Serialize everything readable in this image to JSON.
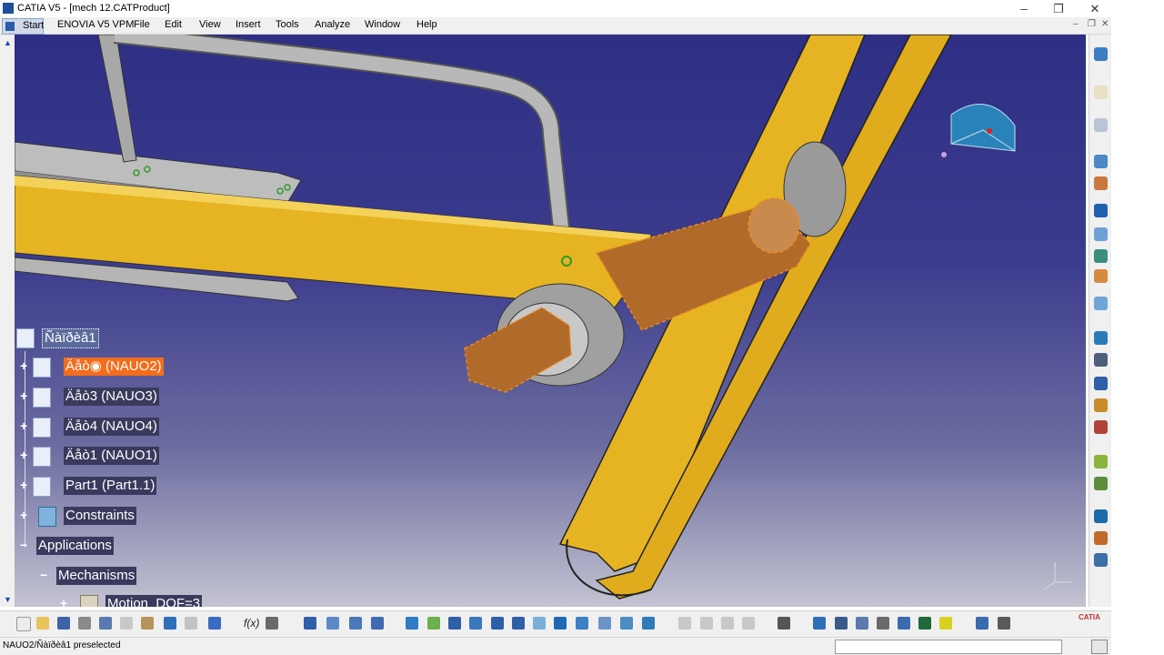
{
  "window": {
    "title": "CATIA V5 - [mech 12.CATProduct]",
    "minimize_icon": "minimize-icon",
    "restore_icon": "restore-icon",
    "close_icon": "close-icon"
  },
  "menu": {
    "start": "Start",
    "items": [
      "ENOVIA V5 VPM",
      "File",
      "Edit",
      "View",
      "Insert",
      "Tools",
      "Analyze",
      "Window",
      "Help"
    ]
  },
  "tree": {
    "root": "Ñàïðèâ1",
    "nodes": [
      {
        "label": "Äåòàëü (NAUO2)",
        "display": "Äåò◉ (NAUO2)",
        "selected": true
      },
      {
        "label": "Äåò3 (NAUO3)",
        "display": "Äåò3 (NAUO3)"
      },
      {
        "label": "Äåò4 (NAUO4)",
        "display": "Äåò4 (NAUO4)"
      },
      {
        "label": "Äåò1 (NAUO1)",
        "display": "Äåò1 (NAUO1)"
      },
      {
        "label": "Part1 (Part1.1)",
        "display": "Part1 (Part1.1)"
      },
      {
        "label": "Constraints",
        "display": "Constraints"
      },
      {
        "label": "Applications",
        "display": "Applications"
      },
      {
        "label": "Mechanisms",
        "display": "Mechanisms"
      },
      {
        "label": "Motion_DOF=3",
        "display": "Motion_DOF=3"
      }
    ]
  },
  "toolbar": {
    "formula_label": "f(x)"
  },
  "status": {
    "message": "NAUO2/Ñàïðèâ1 preselected"
  },
  "brand": {
    "logo_text": "CATIA"
  },
  "colors": {
    "viewport_top": "#2e2e84",
    "viewport_bottom": "#c3c3d2",
    "frame_yellow": "#e6b422",
    "pin_copper": "#b06a2a",
    "selected_node": "#f36d1b"
  }
}
